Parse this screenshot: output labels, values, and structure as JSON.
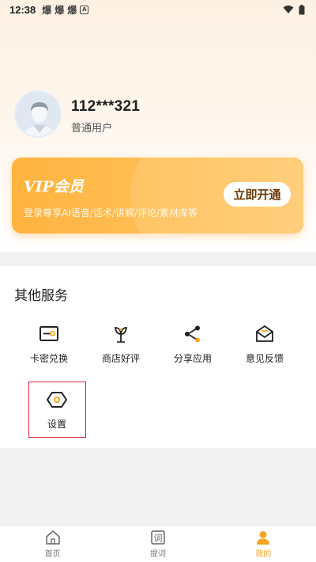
{
  "status_bar": {
    "time": "12:38",
    "app_glyphs": [
      "爆",
      "爆",
      "爆"
    ],
    "badge": "A"
  },
  "profile": {
    "username": "112***321",
    "level": "普通用户"
  },
  "vip": {
    "title": "VIP会员",
    "description": "登录尊享AI语音/话术/讲解/评论/素材库等",
    "button_label": "立即开通"
  },
  "services": {
    "title": "其他服务",
    "items": [
      {
        "label": "卡密兑换",
        "icon": "card-key-icon"
      },
      {
        "label": "商店好评",
        "icon": "sprout-icon"
      },
      {
        "label": "分享应用",
        "icon": "share-icon"
      },
      {
        "label": "意见反馈",
        "icon": "feedback-mail-icon"
      },
      {
        "label": "设置",
        "icon": "settings-hex-icon"
      }
    ]
  },
  "tabs": [
    {
      "label": "首页",
      "icon": "home-icon"
    },
    {
      "label": "提词",
      "icon": "prompt-word-icon"
    },
    {
      "label": "我的",
      "icon": "user-icon",
      "active": true
    }
  ],
  "colors": {
    "accent": "#f5a623",
    "vip_gradient_start": "#ffb340",
    "vip_gradient_end": "#ffc86a",
    "highlight": "#e0243a"
  }
}
